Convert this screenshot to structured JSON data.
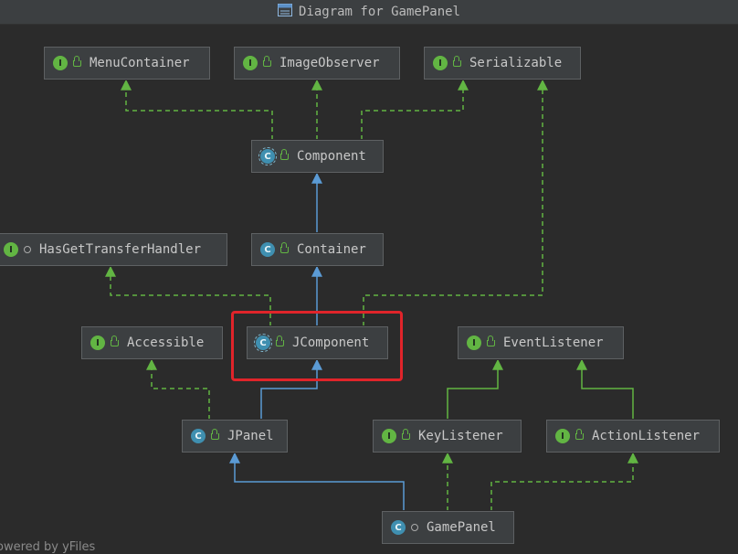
{
  "window": {
    "title": "Diagram for GamePanel"
  },
  "colors": {
    "background": "#2b2b2b",
    "implements_edge": "#62b543",
    "extends_edge": "#5b9bd5",
    "highlight": "#e0242a",
    "interface_badge": "#62b543",
    "class_badge": "#3f8fb0"
  },
  "nodes": {
    "menucontainer": {
      "label": "MenuContainer",
      "kind": "interface",
      "kind_letter": "I",
      "visibility": "public"
    },
    "imageobserver": {
      "label": "ImageObserver",
      "kind": "interface",
      "kind_letter": "I",
      "visibility": "public"
    },
    "serializable": {
      "label": "Serializable",
      "kind": "interface",
      "kind_letter": "I",
      "visibility": "public"
    },
    "component": {
      "label": "Component",
      "kind": "abstract class",
      "kind_letter": "C",
      "visibility": "public"
    },
    "hasgettransferhandler": {
      "label": "HasGetTransferHandler",
      "kind": "interface",
      "kind_letter": "I",
      "visibility": "package"
    },
    "container": {
      "label": "Container",
      "kind": "class",
      "kind_letter": "C",
      "visibility": "public"
    },
    "accessible": {
      "label": "Accessible",
      "kind": "interface",
      "kind_letter": "I",
      "visibility": "public"
    },
    "jcomponent": {
      "label": "JComponent",
      "kind": "abstract class",
      "kind_letter": "C",
      "visibility": "public"
    },
    "eventlistener": {
      "label": "EventListener",
      "kind": "interface",
      "kind_letter": "I",
      "visibility": "public"
    },
    "jpanel": {
      "label": "JPanel",
      "kind": "class",
      "kind_letter": "C",
      "visibility": "public"
    },
    "keylistener": {
      "label": "KeyListener",
      "kind": "interface",
      "kind_letter": "I",
      "visibility": "public"
    },
    "actionlistener": {
      "label": "ActionListener",
      "kind": "interface",
      "kind_letter": "I",
      "visibility": "public"
    },
    "gamepanel": {
      "label": "GamePanel",
      "kind": "class",
      "kind_letter": "C",
      "visibility": "package"
    }
  },
  "edges": [
    {
      "from": "Component",
      "to": "MenuContainer",
      "relation": "implements"
    },
    {
      "from": "Component",
      "to": "ImageObserver",
      "relation": "implements"
    },
    {
      "from": "Component",
      "to": "Serializable",
      "relation": "implements"
    },
    {
      "from": "Container",
      "to": "Component",
      "relation": "extends"
    },
    {
      "from": "JComponent",
      "to": "Container",
      "relation": "extends"
    },
    {
      "from": "JComponent",
      "to": "HasGetTransferHandler",
      "relation": "implements"
    },
    {
      "from": "JComponent",
      "to": "Serializable",
      "relation": "implements"
    },
    {
      "from": "JPanel",
      "to": "JComponent",
      "relation": "extends"
    },
    {
      "from": "JPanel",
      "to": "Accessible",
      "relation": "implements"
    },
    {
      "from": "KeyListener",
      "to": "EventListener",
      "relation": "extends"
    },
    {
      "from": "ActionListener",
      "to": "EventListener",
      "relation": "extends"
    },
    {
      "from": "GamePanel",
      "to": "JPanel",
      "relation": "extends"
    },
    {
      "from": "GamePanel",
      "to": "KeyListener",
      "relation": "implements"
    },
    {
      "from": "GamePanel",
      "to": "ActionListener",
      "relation": "implements"
    }
  ],
  "highlighted_node": "JComponent",
  "footer": {
    "text": "owered by yFiles"
  }
}
